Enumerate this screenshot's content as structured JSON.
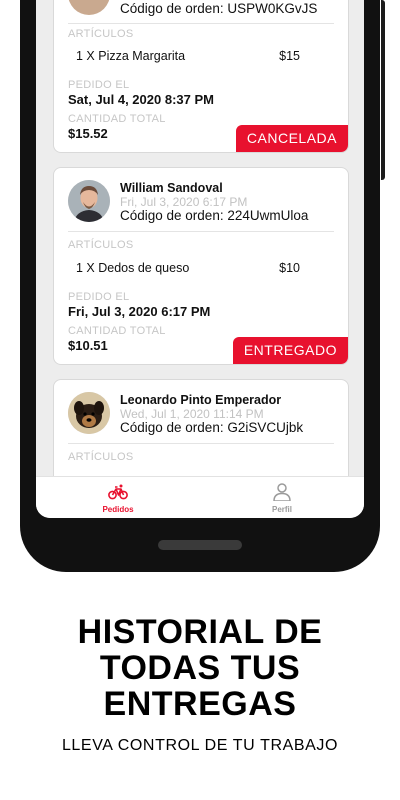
{
  "orders": [
    {
      "name": "",
      "date": "",
      "code": "Código de orden: USPW0KGvJS",
      "items_label": "ARTÍCULOS",
      "items": [
        {
          "text": "1 X Pizza Margarita",
          "price": "$15"
        }
      ],
      "ordered_label": "PEDIDO EL",
      "ordered_at": "Sat, Jul 4, 2020 8:37 PM",
      "total_label": "CANTIDAD TOTAL",
      "total": "$15.52",
      "status": "CANCELADA",
      "status_color": "#e8112e"
    },
    {
      "name": "William Sandoval",
      "date": "Fri, Jul 3, 2020 6:17 PM",
      "code": "Código de orden: 224UwmUloa",
      "items_label": "ARTÍCULOS",
      "items": [
        {
          "text": "1 X Dedos de queso",
          "price": "$10"
        }
      ],
      "ordered_label": "PEDIDO EL",
      "ordered_at": "Fri, Jul 3, 2020 6:17 PM",
      "total_label": "CANTIDAD TOTAL",
      "total": "$10.51",
      "status": "ENTREGADO",
      "status_color": "#e8112e"
    },
    {
      "name": "Leonardo Pinto Emperador",
      "date": "Wed, Jul 1, 2020 11:14 PM",
      "code": "Código de orden: G2iSVCUjbk",
      "items_label": "ARTÍCULOS"
    }
  ],
  "tabs": [
    {
      "label": "Pedidos",
      "icon": "bicycle-icon",
      "active": true,
      "color": "#e8112e"
    },
    {
      "label": "Perfil",
      "icon": "user-icon",
      "active": false,
      "color": "#9a9a9a"
    }
  ],
  "promo": {
    "headline_lines": [
      "HISTORIAL DE",
      "TODAS TUS",
      "ENTREGAS"
    ],
    "subline": "LLEVA CONTROL DE TU TRABAJO"
  }
}
